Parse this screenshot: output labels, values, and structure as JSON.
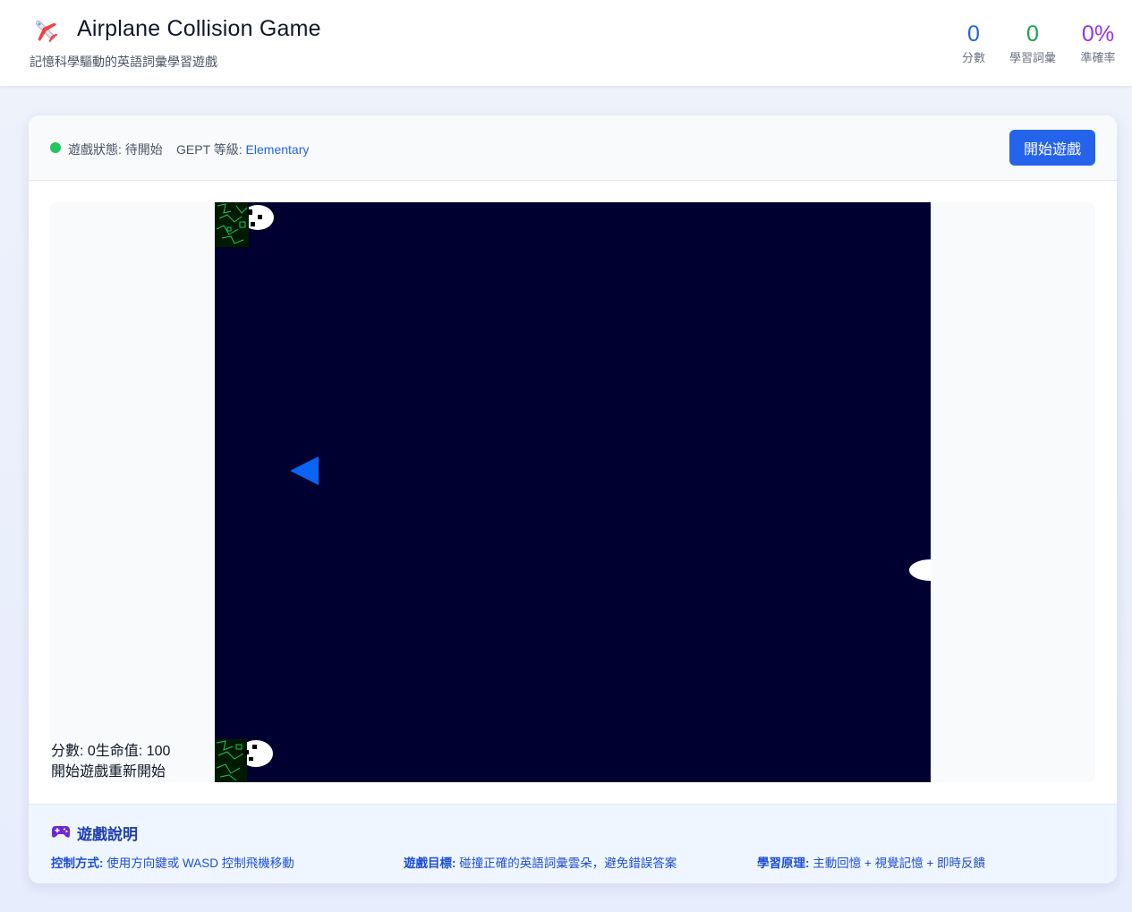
{
  "header": {
    "title": "Airplane Collision Game",
    "subtitle": "記憶科學驅動的英語詞彙學習遊戲",
    "logo_icon": "airplane-icon"
  },
  "stats": {
    "score": {
      "value": "0",
      "label": "分數",
      "color": "#2563eb"
    },
    "vocab": {
      "value": "0",
      "label": "學習詞彙",
      "color": "#16a34a"
    },
    "accuracy": {
      "value": "0%",
      "label": "準確率",
      "color": "#9333ea"
    }
  },
  "control_bar": {
    "status_label": "遊戲狀態:",
    "status_value": "待開始",
    "status_color": "#22c55e",
    "level_label": "GEPT 等級:",
    "level_value": "Elementary",
    "start_button": "開始遊戲"
  },
  "game": {
    "background_color": "#000030",
    "player_icon": "player-plane-triangle-icon",
    "hud_score": "分數: 0",
    "hud_lives": "生命值: 100",
    "hud_start": "開始遊戲",
    "hud_restart": "重新開始"
  },
  "footer": {
    "title": "遊戲說明",
    "icon": "gamepad-icon",
    "items": [
      {
        "label": "控制方式:",
        "text": "使用方向鍵或 WASD 控制飛機移動"
      },
      {
        "label": "遊戲目標:",
        "text": "碰撞正確的英語詞彙雲朵，避免錯誤答案"
      },
      {
        "label": "學習原理:",
        "text": "主動回憶 + 視覺記憶 + 即時反饋"
      }
    ]
  }
}
